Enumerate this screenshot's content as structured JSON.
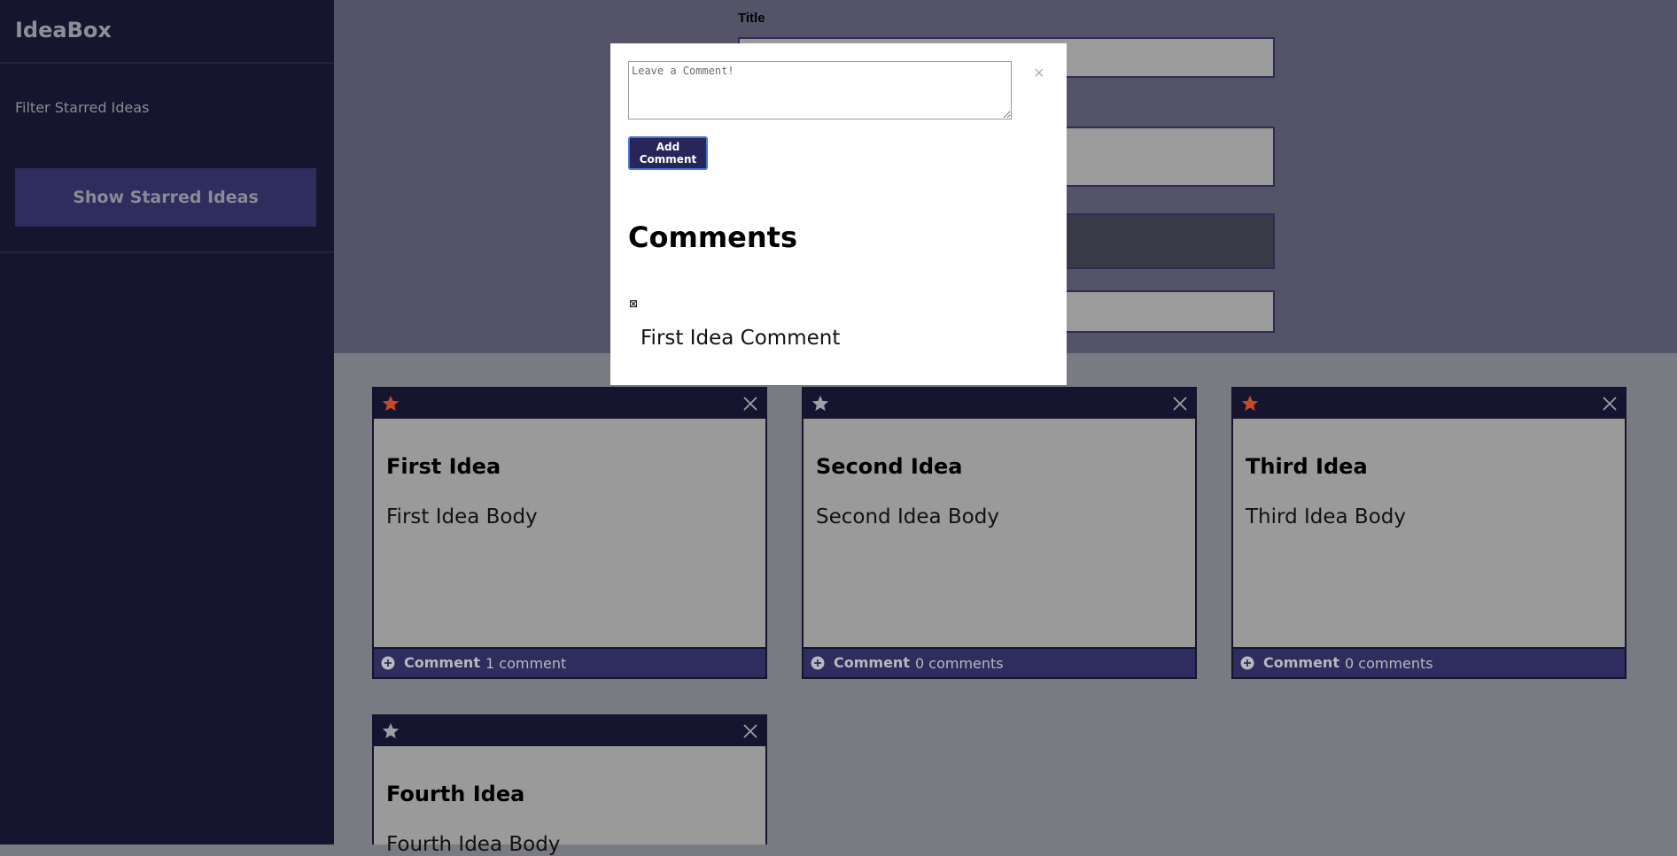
{
  "sidebar": {
    "brand": "IdeaBox",
    "filter_label": "Filter Starred Ideas",
    "show_starred_label": "Show Starred Ideas"
  },
  "form": {
    "title_label": "Title"
  },
  "modal": {
    "comment_placeholder": "Leave a Comment!",
    "close_glyph": "×",
    "add_comment_label": "Add Comment",
    "comments_heading": "Comments",
    "comments": [
      {
        "delete_glyph": "⊠",
        "text": "First Idea Comment"
      }
    ]
  },
  "ideas": [
    {
      "title": "First Idea",
      "body": "First Idea Body",
      "starred": true,
      "comment_label": "Comment",
      "comment_count": "1 comment"
    },
    {
      "title": "Second Idea",
      "body": "Second Idea Body",
      "starred": false,
      "comment_label": "Comment",
      "comment_count": "0 comments"
    },
    {
      "title": "Third Idea",
      "body": "Third Idea Body",
      "starred": true,
      "comment_label": "Comment",
      "comment_count": "0 comments"
    },
    {
      "title": "Fourth Idea",
      "body": "Fourth Idea Body",
      "starred": false,
      "comment_label": "",
      "comment_count": ""
    }
  ],
  "colors": {
    "star_active": "#c44a2c",
    "star_inactive": "#9e9ea4"
  },
  "icons": {
    "star": "star-icon",
    "close": "close-icon",
    "plus": "plus-circle-icon"
  }
}
